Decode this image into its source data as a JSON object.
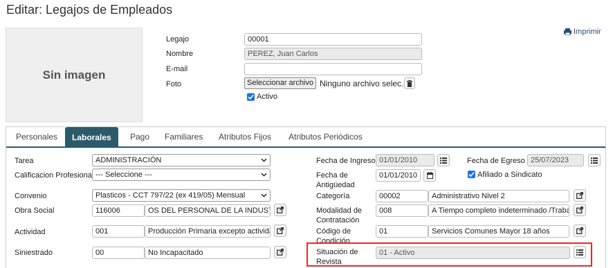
{
  "title": "Editar: Legajos de Empleados",
  "print_label": "Imprimir",
  "photo": {
    "placeholder": "Sin imagen"
  },
  "header_fields": {
    "legajo": {
      "label": "Legajo",
      "value": "00001"
    },
    "nombre": {
      "label": "Nombre",
      "value": "PEREZ, Juan Carlos"
    },
    "email": {
      "label": "E-mail",
      "value": ""
    },
    "foto": {
      "label": "Foto",
      "button": "Seleccionar archivo",
      "status": "Ninguno archivo selec."
    },
    "activo": {
      "label": "Activo",
      "checked": true
    }
  },
  "tabs": [
    {
      "label": "Personales",
      "active": false
    },
    {
      "label": "Laborales",
      "active": true
    },
    {
      "label": "Pago",
      "active": false
    },
    {
      "label": "Familiares",
      "active": false
    },
    {
      "label": "Atributos Fijos",
      "active": false
    },
    {
      "label": "Atributos Periódicos",
      "active": false
    }
  ],
  "left_fields": {
    "tarea": {
      "label": "Tarea",
      "value": "ADMINISTRACIÓN"
    },
    "calificacion": {
      "label": "Calificacion Profesional",
      "value": "--- Seleccione ---"
    },
    "convenio": {
      "label": "Convenio",
      "value": "Plasticos - CCT 797/22 (ex 419/05) Mensual"
    },
    "obra_social": {
      "label": "Obra Social",
      "code": "116006",
      "desc": "OS  DEL PERSONAL DE LA INDUSTRIA"
    },
    "actividad": {
      "label": "Actividad",
      "code": "001",
      "desc": "Producción Primaria excepto actividad"
    },
    "siniestrado": {
      "label": "Siniestrado",
      "code": "00",
      "desc": "No Incapacitado"
    }
  },
  "right_fields": {
    "fecha_ingreso": {
      "label": "Fecha de Ingreso",
      "value": "01/01/2010"
    },
    "fecha_egreso": {
      "label": "Fecha de Egreso",
      "value": "25/07/2023"
    },
    "fecha_antiguedad": {
      "label": "Fecha de Antigüedad",
      "value": "01/01/2010"
    },
    "afiliado": {
      "label": "Afiliado a Sindicato",
      "checked": true
    },
    "categoria": {
      "label": "Categoría",
      "code": "00002",
      "desc": "Administrativo Nivel 2"
    },
    "modalidad": {
      "label": "Modalidad de Contratación",
      "code": "008",
      "desc": "A Tiempo completo indeterminado /Trabajo"
    },
    "codigo_condicion": {
      "label": "Código de Condición",
      "code": "01",
      "desc": "Servicios Comunes Mayor 18 años"
    },
    "situacion_revista": {
      "label": "Situación de Revista",
      "value": "01 - Activo"
    }
  },
  "colors": {
    "tab_active": "#2c5a6b",
    "checkbox": "#1a73e8",
    "highlight": "#d9302f",
    "link": "#2a4a7a"
  }
}
